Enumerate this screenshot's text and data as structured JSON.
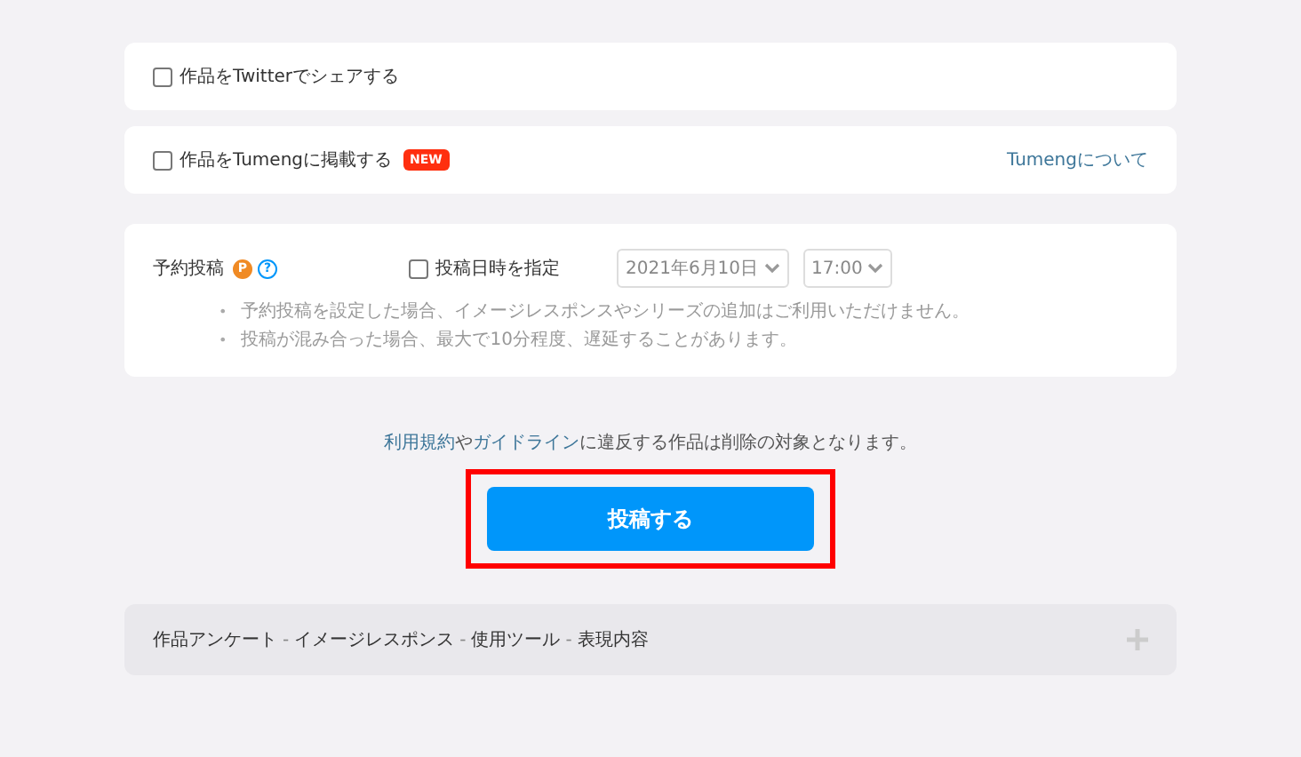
{
  "share_options": [
    {
      "kind": "plain",
      "label": "作品をTwitterでシェアする",
      "checked": false
    },
    {
      "kind": "new",
      "label": "作品をTumengに掲載する",
      "badge": "NEW",
      "checked": false,
      "link": "Tumengについて"
    }
  ],
  "schedule": {
    "label": "予約投稿",
    "premium_badge": "P",
    "help": "?",
    "specify_label": "投稿日時を指定",
    "specify_checked": false,
    "date": "2021年6月10日",
    "time": "17:00",
    "disabled": true,
    "notes": [
      {
        "bullet": "•",
        "text": "予約投稿を設定した場合、イメージレスポンスやシリーズの追加はご利用いただけません。"
      },
      {
        "bullet": "•",
        "text": "投稿が混み合った場合、最大で10分程度、遅延することがあります。"
      }
    ]
  },
  "terms": [
    {
      "kind": "link",
      "text": "利用規約"
    },
    {
      "kind": "text",
      "text": "や"
    },
    {
      "kind": "link",
      "text": "ガイドライン"
    },
    {
      "kind": "text",
      "text": "に違反する作品は削除の対象となります。"
    }
  ],
  "submit_button": {
    "label": "投稿する",
    "highlighted": true
  },
  "details_section": {
    "expanded": false,
    "items": [
      {
        "kind": "label",
        "text": "作品アンケート"
      },
      {
        "kind": "separator",
        "text": "-"
      },
      {
        "kind": "label",
        "text": "イメージレスポンス"
      },
      {
        "kind": "separator",
        "text": "-"
      },
      {
        "kind": "label",
        "text": "使用ツール"
      },
      {
        "kind": "separator",
        "text": "-"
      },
      {
        "kind": "label",
        "text": "表現内容"
      }
    ]
  }
}
